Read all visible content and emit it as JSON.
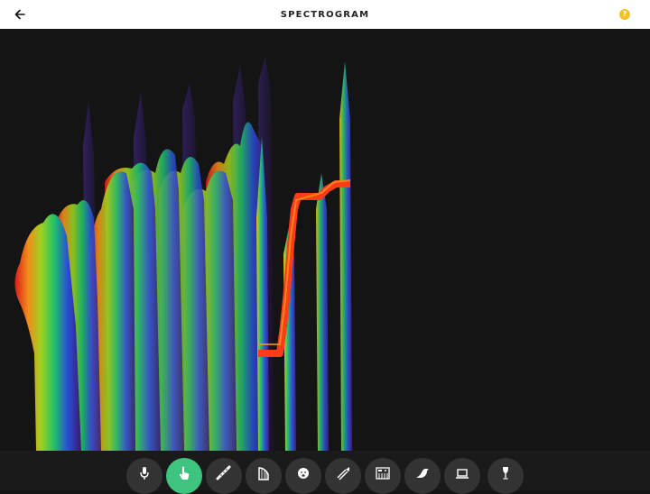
{
  "header": {
    "title": "SPECTROGRAM",
    "back_icon": "arrow-left-icon",
    "help_icon": "question-circle-icon",
    "help_glyph": "?"
  },
  "colors": {
    "topbar_bg": "#ffffff",
    "canvas_bg": "#141414",
    "help_accent": "#f2c12e",
    "tool_bg": "#333333",
    "tool_active": "#3ec47f",
    "tool_icon": "#ffffff"
  },
  "toolbar": {
    "active_index": 1,
    "tools": [
      {
        "name": "microphone",
        "icon": "microphone-icon"
      },
      {
        "name": "touch",
        "icon": "hand-pointer-icon"
      },
      {
        "name": "flute",
        "icon": "flute-icon"
      },
      {
        "name": "harp",
        "icon": "harp-icon"
      },
      {
        "name": "voice",
        "icon": "face-icon"
      },
      {
        "name": "trombone",
        "icon": "trombone-icon"
      },
      {
        "name": "synthesizer",
        "icon": "keyboard-synth-icon"
      },
      {
        "name": "bird",
        "icon": "bird-icon"
      },
      {
        "name": "computer",
        "icon": "laptop-icon"
      },
      {
        "name": "wine-glass",
        "icon": "wine-glass-icon"
      }
    ]
  }
}
